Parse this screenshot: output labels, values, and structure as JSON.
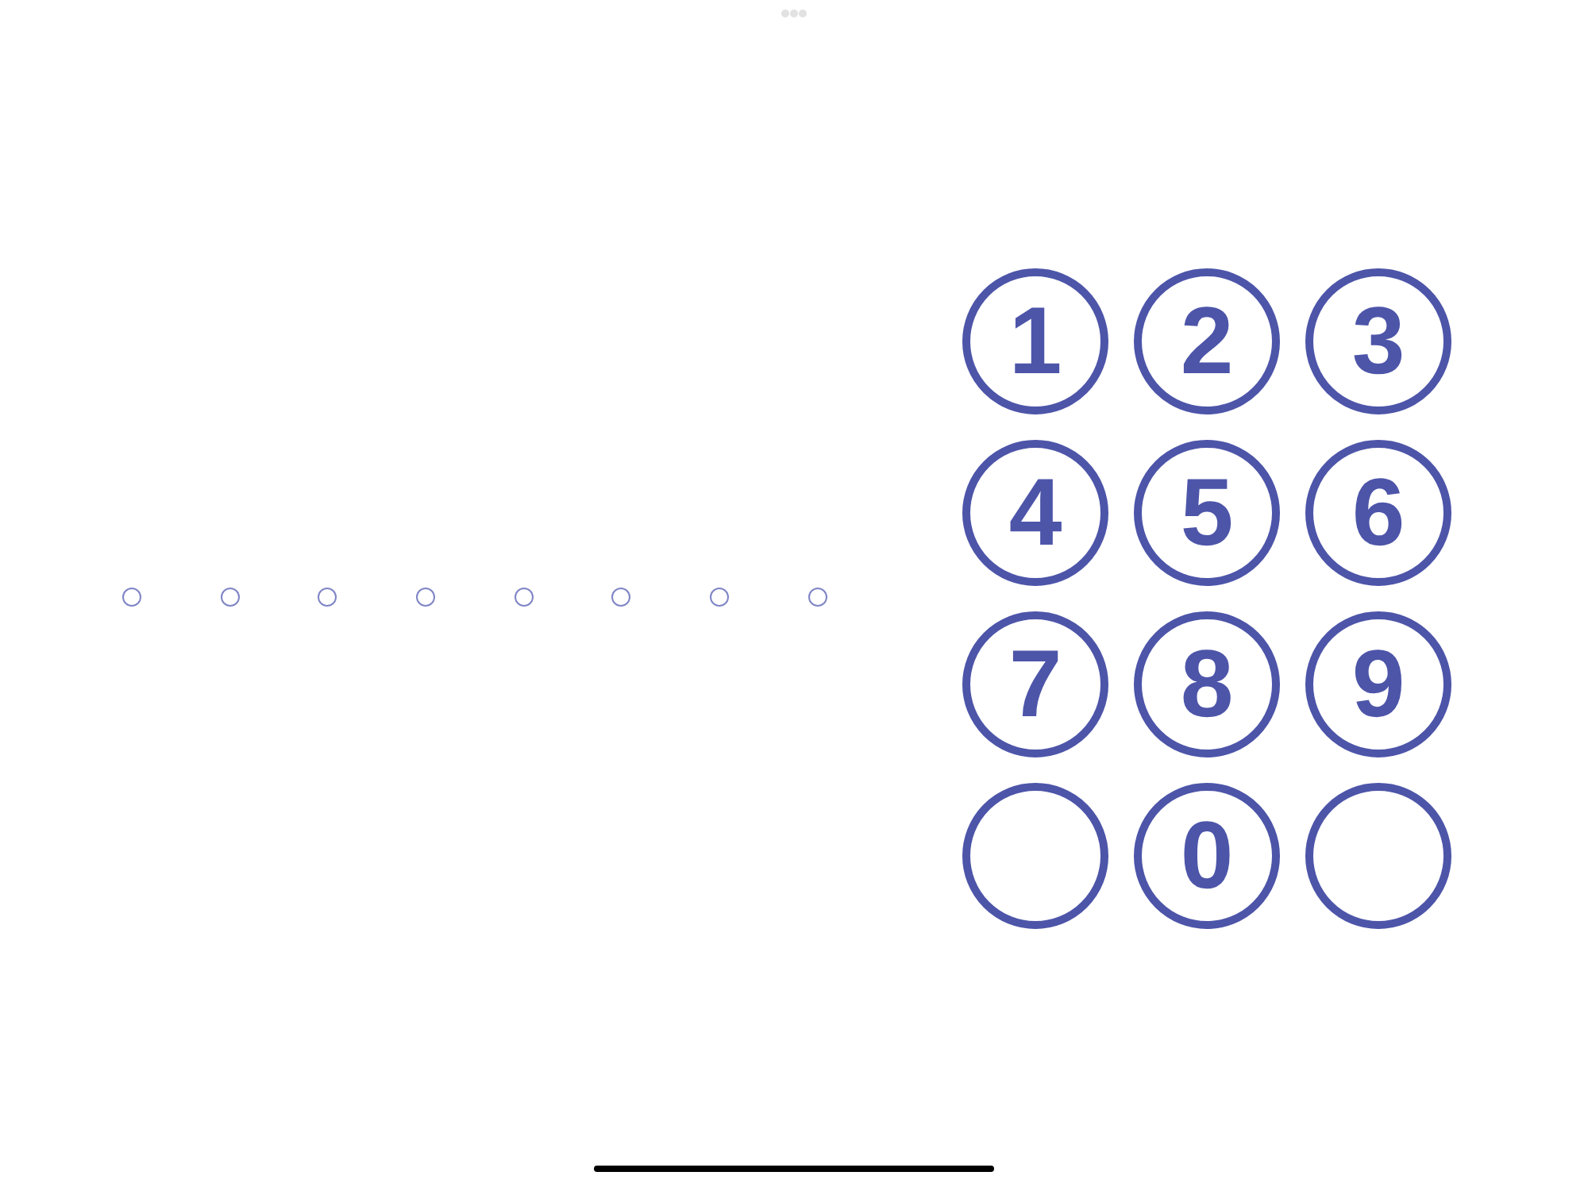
{
  "pin_dots": [
    {
      "filled": false
    },
    {
      "filled": false
    },
    {
      "filled": false
    },
    {
      "filled": false
    },
    {
      "filled": false
    },
    {
      "filled": false
    },
    {
      "filled": false
    },
    {
      "filled": false
    }
  ],
  "keypad": [
    {
      "kind": "digit",
      "label": "1"
    },
    {
      "kind": "digit",
      "label": "2"
    },
    {
      "kind": "digit",
      "label": "3"
    },
    {
      "kind": "digit",
      "label": "4"
    },
    {
      "kind": "digit",
      "label": "5"
    },
    {
      "kind": "digit",
      "label": "6"
    },
    {
      "kind": "digit",
      "label": "7"
    },
    {
      "kind": "digit",
      "label": "8"
    },
    {
      "kind": "digit",
      "label": "9"
    },
    {
      "kind": "blank"
    },
    {
      "kind": "digit",
      "label": "0"
    },
    {
      "kind": "blank"
    }
  ]
}
